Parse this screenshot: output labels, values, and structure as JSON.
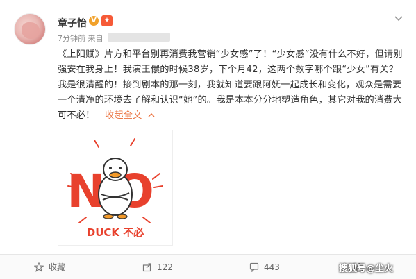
{
  "post": {
    "author": "章子怡",
    "verified_badge": "V",
    "time": "7分钟前",
    "source_prefix": "来自",
    "paragraph": "《上阳赋》片方和平台别再消费我营销“少女感”了！“少女感”没有什么不好，但请别强安在我身上！我演王儇的时候38岁，下个月42，这两个数字哪个跟“少女”有关？我是很清醒的！接到剧本的那一刻，我就知道要跟阿妩一起成长和变化，观众是需要一个清净的环境去了解和认识“她”的。我是本本分分地塑造角色，其它对我的消费大可不必！",
    "expand_label": "收起全文",
    "image": {
      "big_text": "NO",
      "caption": "DUCK 不必"
    }
  },
  "toolbar": {
    "favorite_label": "收藏",
    "share_count": "122",
    "comment_count": "443",
    "like_count": ""
  },
  "watermark": "搜狐号@尘火",
  "colors": {
    "accent": "#eb7340",
    "no_red": "#e8412d",
    "badge_orange": "#f1a12a"
  }
}
